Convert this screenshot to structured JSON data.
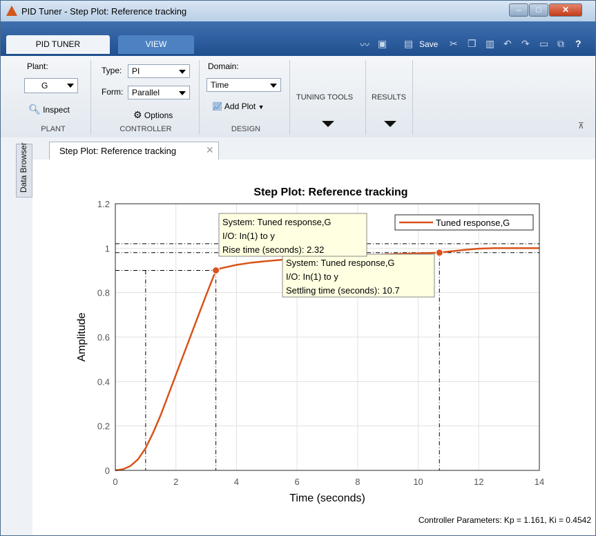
{
  "window": {
    "title": "PID Tuner - Step Plot: Reference tracking",
    "controls": {
      "minimize": "–",
      "maximize": "□",
      "close": "✕"
    }
  },
  "tabs": [
    {
      "label": "PID TUNER"
    },
    {
      "label": "VIEW"
    }
  ],
  "quick_access": {
    "save_label": "Save",
    "help": "?"
  },
  "ribbon": {
    "plant": {
      "label": "Plant:",
      "value": "G",
      "inspect": "Inspect",
      "group": "PLANT"
    },
    "controller": {
      "type_label": "Type:",
      "type_value": "PI",
      "form_label": "Form:",
      "form_value": "Parallel",
      "options": "Options",
      "group": "CONTROLLER"
    },
    "design": {
      "domain_label": "Domain:",
      "domain_value": "Time",
      "add_plot": "Add Plot",
      "group": "DESIGN"
    },
    "tuning_tools": "TUNING TOOLS",
    "results": "RESULTS"
  },
  "data_browser": "Data Browser",
  "document_tab": {
    "label": "Step Plot: Reference tracking",
    "close": "✕"
  },
  "chart_data": {
    "type": "line",
    "title": "Step Plot: Reference tracking",
    "xlabel": "Time (seconds)",
    "ylabel": "Amplitude",
    "xlim": [
      0,
      14
    ],
    "ylim": [
      0,
      1.2
    ],
    "xticks": [
      0,
      2,
      4,
      6,
      8,
      10,
      12,
      14
    ],
    "yticks": [
      0,
      0.2,
      0.4,
      0.6,
      0.8,
      1,
      1.2
    ],
    "xtick_labels": [
      "0",
      "2",
      "4",
      "6",
      "8",
      "10",
      "12",
      "14"
    ],
    "ytick_labels": [
      "0",
      "0.2",
      "0.4",
      "0.6",
      "0.8",
      "1",
      "1.2"
    ],
    "grid": true,
    "legend": {
      "placement": "top-right",
      "entries": [
        "Tuned response,G"
      ]
    },
    "color": "#d95319",
    "series": [
      {
        "name": "Tuned response,G",
        "x": [
          0,
          0.25,
          0.5,
          0.75,
          1.0,
          1.25,
          1.5,
          1.75,
          2.0,
          2.25,
          2.5,
          2.75,
          3.0,
          3.32,
          3.5,
          4.0,
          4.5,
          5.0,
          5.5,
          6.0,
          6.5,
          7.0,
          7.5,
          8.0,
          8.5,
          9.0,
          9.5,
          10.0,
          10.7,
          11.0,
          11.5,
          12.0,
          12.5,
          13.0,
          13.5,
          14.0
        ],
        "y": [
          0,
          0.005,
          0.02,
          0.05,
          0.1,
          0.17,
          0.25,
          0.34,
          0.43,
          0.52,
          0.61,
          0.7,
          0.79,
          0.9,
          0.91,
          0.925,
          0.935,
          0.942,
          0.948,
          0.953,
          0.957,
          0.961,
          0.964,
          0.967,
          0.97,
          0.972,
          0.975,
          0.977,
          0.98,
          0.985,
          0.992,
          0.998,
          1.0,
          1.0,
          1.0,
          1.0
        ]
      }
    ],
    "reference_lines": {
      "rise_low": 0.1,
      "rise_high": 0.9,
      "settle_low": 0.98,
      "settle_high": 1.02,
      "rise_start_time": 1.0
    },
    "annotations": [
      {
        "x": 3.32,
        "y": 0.9,
        "lines": [
          "System: Tuned response,G",
          "I/O: In(1) to y",
          "Rise time (seconds): 2.32"
        ]
      },
      {
        "x": 10.7,
        "y": 0.98,
        "lines": [
          "System: Tuned response,G",
          "I/O: In(1) to y",
          "Settling time (seconds): 10.7"
        ]
      }
    ]
  },
  "status_bar": "Controller Parameters: Kp = 1.161, Ki = 0.4542"
}
